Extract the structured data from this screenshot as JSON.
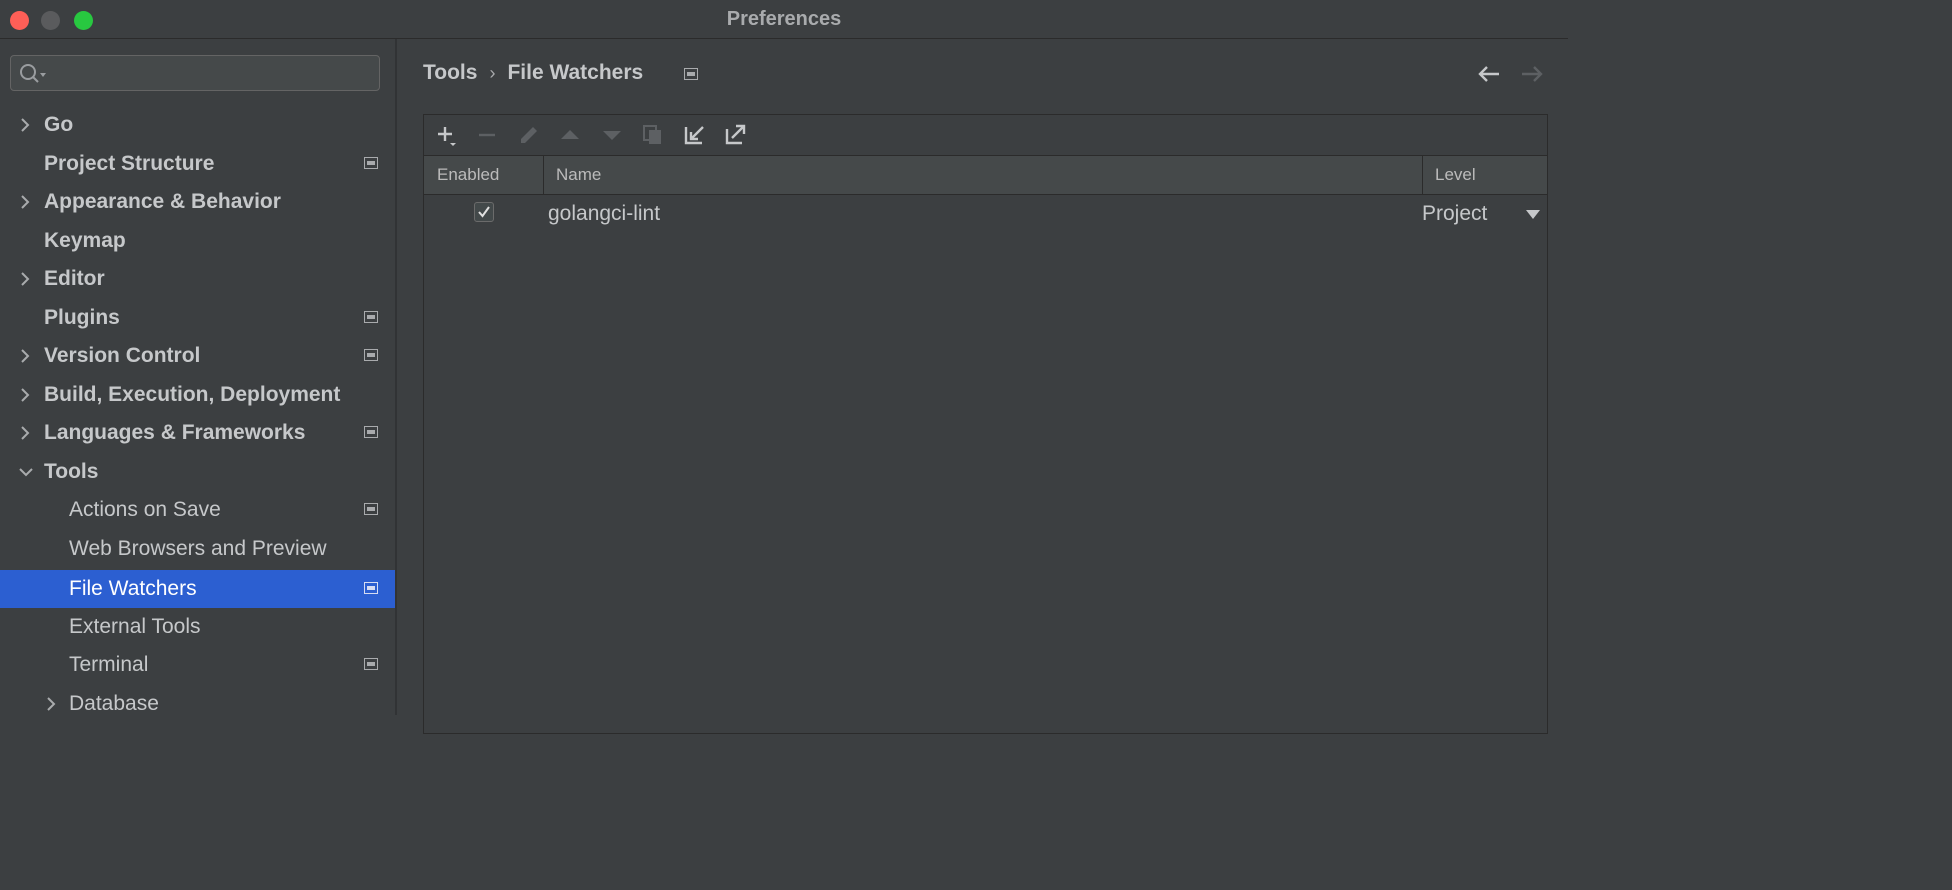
{
  "window": {
    "title": "Preferences"
  },
  "sidebar": {
    "search": {
      "placeholder": ""
    },
    "items": [
      {
        "label": "Go"
      },
      {
        "label": "Project Structure"
      },
      {
        "label": "Appearance & Behavior"
      },
      {
        "label": "Keymap"
      },
      {
        "label": "Editor"
      },
      {
        "label": "Plugins"
      },
      {
        "label": "Version Control"
      },
      {
        "label": "Build, Execution, Deployment"
      },
      {
        "label": "Languages & Frameworks"
      },
      {
        "label": "Tools"
      },
      {
        "label": "Actions on Save"
      },
      {
        "label": "Web Browsers and Preview"
      },
      {
        "label": "File Watchers"
      },
      {
        "label": "External Tools"
      },
      {
        "label": "Terminal"
      },
      {
        "label": "Database"
      }
    ]
  },
  "breadcrumb": {
    "parent": "Tools",
    "separator": "›",
    "current": "File Watchers"
  },
  "table": {
    "columns": {
      "enabled": "Enabled",
      "name": "Name",
      "level": "Level"
    },
    "rows": [
      {
        "enabled": true,
        "name": "golangci-lint",
        "level": "Project"
      }
    ]
  },
  "colors": {
    "selection": "#2c5fd1",
    "background": "#3c3f41"
  }
}
